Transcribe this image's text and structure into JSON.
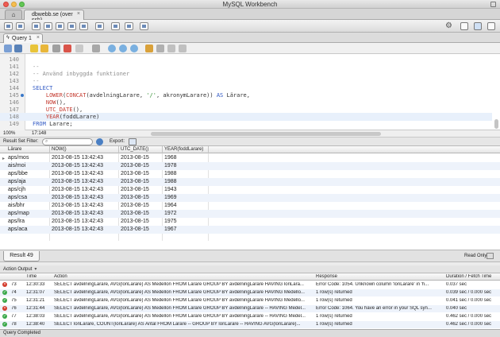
{
  "window": {
    "title": "MySQL Workbench"
  },
  "tabs": {
    "home_icon": "home-icon",
    "connection": "dbwebb.se (over ssh)"
  },
  "query_tab": {
    "label": "Query 1"
  },
  "editor": {
    "lines": [
      {
        "num": "140",
        "text": ""
      },
      {
        "num": "141",
        "text": ""
      },
      {
        "num": "142",
        "text": "--"
      },
      {
        "num": "143",
        "text": "-- Använd inbyggda funktioner"
      },
      {
        "num": "144",
        "text": "--"
      },
      {
        "num": "145",
        "text": "SELECT"
      },
      {
        "num": "146",
        "text": "    LOWER(CONCAT(avdelningLarare, '/', akronymLarare)) AS Lärare,"
      },
      {
        "num": "147",
        "text": "    NOW(),"
      },
      {
        "num": "148",
        "text": "    UTC_DATE(),"
      },
      {
        "num": "149",
        "text": "    YEAR(foddLarare)"
      },
      {
        "num": "150",
        "text": "FROM Larare;"
      },
      {
        "num": "151",
        "text": ""
      }
    ],
    "display_lines": [
      {
        "num": "140",
        "parts": []
      },
      {
        "num": "141",
        "parts": [
          {
            "c": "c-cmt",
            "t": "--"
          }
        ]
      },
      {
        "num": "142",
        "parts": [
          {
            "c": "c-cmt",
            "t": "-- Använd inbyggda funktioner"
          }
        ]
      },
      {
        "num": "143",
        "parts": [
          {
            "c": "c-cmt",
            "t": "--"
          }
        ]
      },
      {
        "num": "144",
        "parts": [
          {
            "c": "c-kw",
            "t": "SELECT"
          }
        ]
      },
      {
        "num": "145",
        "parts": [
          {
            "c": "c-id",
            "t": "    "
          },
          {
            "c": "c-fn",
            "t": "LOWER"
          },
          {
            "c": "c-id",
            "t": "("
          },
          {
            "c": "c-fn",
            "t": "CONCAT"
          },
          {
            "c": "c-id",
            "t": "(avdelningLarare, "
          },
          {
            "c": "c-str",
            "t": "'/'"
          },
          {
            "c": "c-id",
            "t": ", akronymLarare)) "
          },
          {
            "c": "c-kw",
            "t": "AS"
          },
          {
            "c": "c-id",
            "t": " Lärare,"
          }
        ]
      },
      {
        "num": "146",
        "parts": [
          {
            "c": "c-id",
            "t": "    "
          },
          {
            "c": "c-fn",
            "t": "NOW"
          },
          {
            "c": "c-id",
            "t": "(),"
          }
        ]
      },
      {
        "num": "147",
        "parts": [
          {
            "c": "c-id",
            "t": "    "
          },
          {
            "c": "c-fn",
            "t": "UTC_DATE"
          },
          {
            "c": "c-id",
            "t": "(),"
          }
        ]
      },
      {
        "num": "148",
        "parts": [
          {
            "c": "c-id",
            "t": "    "
          },
          {
            "c": "c-fn",
            "t": "YEAR"
          },
          {
            "c": "c-id",
            "t": "(foddLarare)"
          }
        ]
      },
      {
        "num": "149",
        "parts": [
          {
            "c": "c-kw",
            "t": "FROM"
          },
          {
            "c": "c-id",
            "t": " Larare;"
          }
        ]
      }
    ],
    "current_line": "148",
    "zoom": "100%",
    "cursor_pos": "17:148"
  },
  "result_toolbar": {
    "filter_label": "Result Set Filter:",
    "filter_value": "",
    "export_label": "Export:"
  },
  "result_grid": {
    "columns": [
      "Lärare",
      "NOW()",
      "UTC_DATE()",
      "YEAR(foddLarare)"
    ],
    "rows": [
      [
        "aps/mos",
        "2013-08-15 13:42:43",
        "2013-08-15",
        "1968"
      ],
      [
        "ais/moi",
        "2013-08-15 13:42:43",
        "2013-08-15",
        "1978"
      ],
      [
        "aps/bbe",
        "2013-08-15 13:42:43",
        "2013-08-15",
        "1988"
      ],
      [
        "aps/aja",
        "2013-08-15 13:42:43",
        "2013-08-15",
        "1988"
      ],
      [
        "aps/cjh",
        "2013-08-15 13:42:43",
        "2013-08-15",
        "1943"
      ],
      [
        "aps/csa",
        "2013-08-15 13:42:43",
        "2013-08-15",
        "1969"
      ],
      [
        "ais/bhr",
        "2013-08-15 13:42:43",
        "2013-08-15",
        "1964"
      ],
      [
        "aps/map",
        "2013-08-15 13:42:43",
        "2013-08-15",
        "1972"
      ],
      [
        "aps/lra",
        "2013-08-15 13:42:43",
        "2013-08-15",
        "1975"
      ],
      [
        "aps/aca",
        "2013-08-15 13:42:43",
        "2013-08-15",
        "1967"
      ]
    ]
  },
  "result_tab": {
    "label": "Result 49",
    "readonly_label": "Read Only"
  },
  "output": {
    "selector": "Action Output",
    "columns": [
      "",
      "Time",
      "Action",
      "Response",
      "Duration / Fetch Time"
    ],
    "rows": [
      {
        "status": "error",
        "num": "73",
        "time": "12:30:33",
        "action": "SELECT avdelningLarare, AVG(lonLarare) AS Medellon FROM Larare GROUP BY avdelningLarare HAVING lonLara...",
        "response": "Error Code: 1054. Unknown column 'lonLarare' in 'h...",
        "duration": "0.037 sec"
      },
      {
        "status": "ok",
        "num": "74",
        "time": "12:31:07",
        "action": "SELECT avdelningLarare, AVG(lonLarare) AS Medellon FROM Larare GROUP BY avdelningLarare HAVING Medello...",
        "response": "1 row(s) returned",
        "duration": "0.039 sec / 0.000 sec"
      },
      {
        "status": "ok",
        "num": "75",
        "time": "12:31:21",
        "action": "SELECT avdelningLarare, AVG(lonLarare) AS Medellon FROM Larare GROUP BY avdelningLarare HAVING Medello...",
        "response": "1 row(s) returned",
        "duration": "0.041 sec / 0.000 sec"
      },
      {
        "status": "error",
        "num": "76",
        "time": "12:31:44",
        "action": "SELECT avdelningLarare, AVG(lonLarare) AS Medellon FROM Larare GROUP BY avdelningLarare -- HAVING Medel...",
        "response": "Error Code: 1064. You have an error in your SQL syn...",
        "duration": "0.040 sec"
      },
      {
        "status": "ok",
        "num": "77",
        "time": "12:38:03",
        "action": "SELECT avdelningLarare, AVG(lonLarare) AS Medellon FROM Larare GROUP BY avdelningLarare -- HAVING Medel...",
        "response": "1 row(s) returned",
        "duration": "0.462 sec / 0.000 sec"
      },
      {
        "status": "ok",
        "num": "78",
        "time": "12:38:40",
        "action": "SELECT lonLarare, COUNT(lonLarare) AS Antal FROM Larare -- GROUP BY lonLarare -- HAVING AVG(lonLarare)...",
        "response": "1 row(s) returned",
        "duration": "0.462 sec / 0.000 sec"
      }
    ]
  },
  "status_bar": {
    "text": "Query Completed"
  }
}
